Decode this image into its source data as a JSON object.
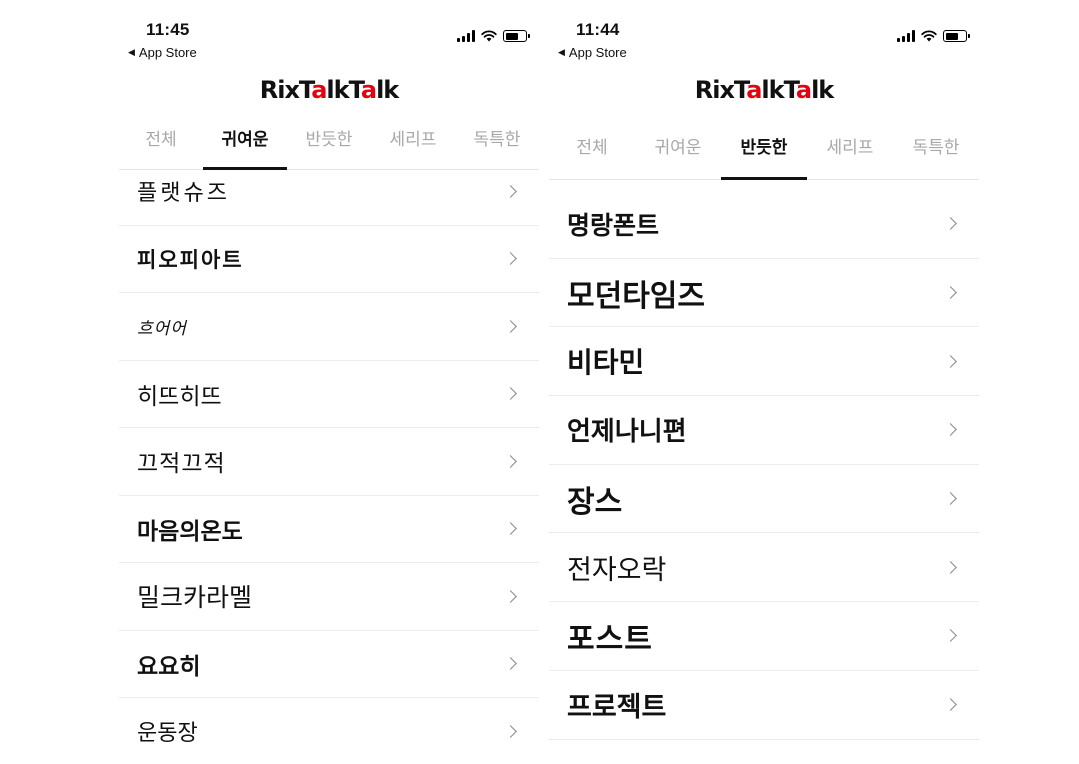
{
  "left": {
    "status": {
      "time": "11:45",
      "back": "App Store"
    },
    "logo": {
      "part1": "RixT",
      "dot": "a",
      "part2": "lkT",
      "dot2": "a",
      "part3": "lk"
    },
    "tabs": [
      {
        "label": "전체",
        "active": false
      },
      {
        "label": "귀여운",
        "active": true
      },
      {
        "label": "반듯한",
        "active": false
      },
      {
        "label": "세리프",
        "active": false
      },
      {
        "label": "독특한",
        "active": false
      }
    ],
    "items": [
      {
        "label": "플랫슈즈"
      },
      {
        "label": "피오피아트"
      },
      {
        "label": "흐어어"
      },
      {
        "label": "히뜨히뜨"
      },
      {
        "label": "끄적끄적"
      },
      {
        "label": "마음의온도"
      },
      {
        "label": "밀크카라멜"
      },
      {
        "label": "요요히"
      },
      {
        "label": "운동장"
      }
    ]
  },
  "right": {
    "status": {
      "time": "11:44",
      "back": "App Store"
    },
    "logo": {
      "part1": "RixT",
      "dot": "a",
      "part2": "lkT",
      "dot2": "a",
      "part3": "lk"
    },
    "tabs": [
      {
        "label": "전체",
        "active": false
      },
      {
        "label": "귀여운",
        "active": false
      },
      {
        "label": "반듯한",
        "active": true
      },
      {
        "label": "세리프",
        "active": false
      },
      {
        "label": "독특한",
        "active": false
      }
    ],
    "items": [
      {
        "label": "명랑폰트"
      },
      {
        "label": "모던타임즈"
      },
      {
        "label": "비타민"
      },
      {
        "label": "언제나니편"
      },
      {
        "label": "장스"
      },
      {
        "label": "전자오락"
      },
      {
        "label": "포스트"
      },
      {
        "label": "프로젝트"
      }
    ]
  },
  "icons": {
    "signal": "cellular-signal-icon",
    "wifi": "wifi-icon",
    "battery": "battery-icon",
    "chevron": "chevron-right-icon",
    "back": "back-triangle-icon"
  },
  "colors": {
    "brand_accent": "#e60012",
    "active_tab": "#111111",
    "inactive_tab": "#a8a8a8"
  }
}
